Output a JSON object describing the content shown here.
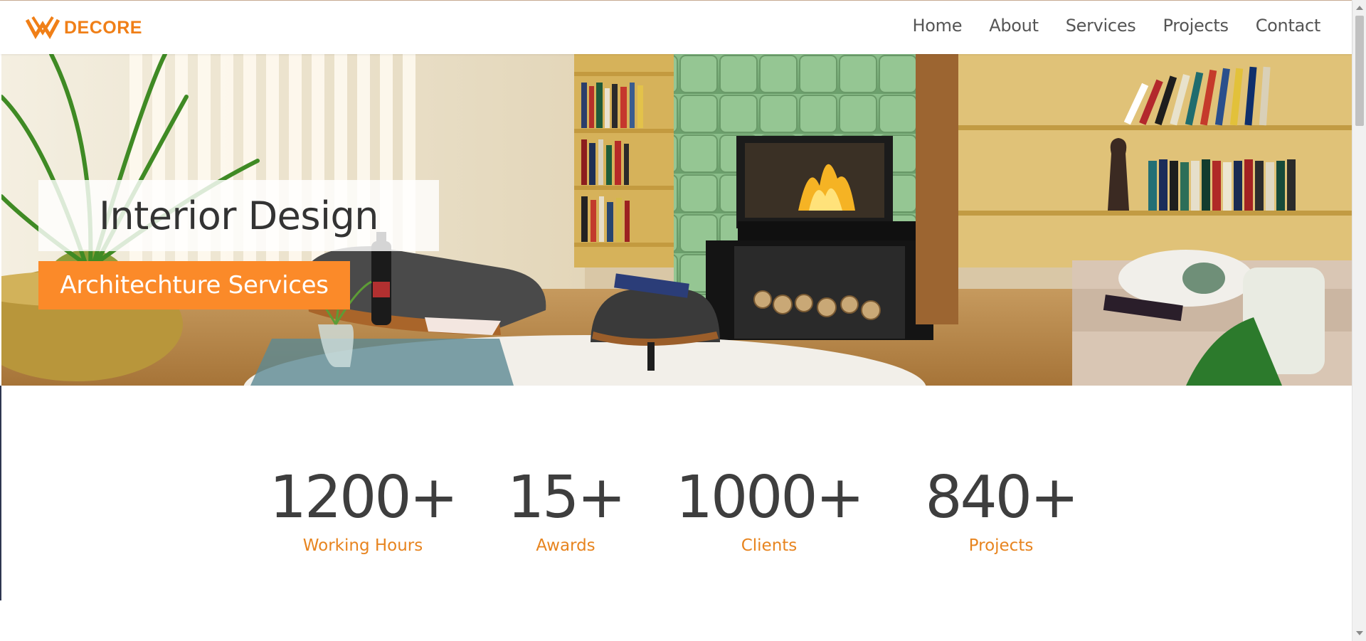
{
  "brand": {
    "name": "DECORE",
    "logo_icon": "decore-logo-icon",
    "accent": "#f07f17"
  },
  "nav": [
    {
      "label": "Home"
    },
    {
      "label": "About"
    },
    {
      "label": "Services"
    },
    {
      "label": "Projects"
    },
    {
      "label": "Contact"
    }
  ],
  "hero": {
    "title": "Interior Design",
    "subtitle": "Architechture Services",
    "subtitle_bg": "#fb8a29"
  },
  "stats": [
    {
      "value": "1200+",
      "label": "Working Hours"
    },
    {
      "value": "15+",
      "label": "Awards"
    },
    {
      "value": "1000+",
      "label": "Clients"
    },
    {
      "value": "840+",
      "label": "Projects"
    }
  ],
  "colors": {
    "stat_number": "#3e3e3e",
    "stat_label": "#e7841f",
    "nav_text": "#555555"
  }
}
